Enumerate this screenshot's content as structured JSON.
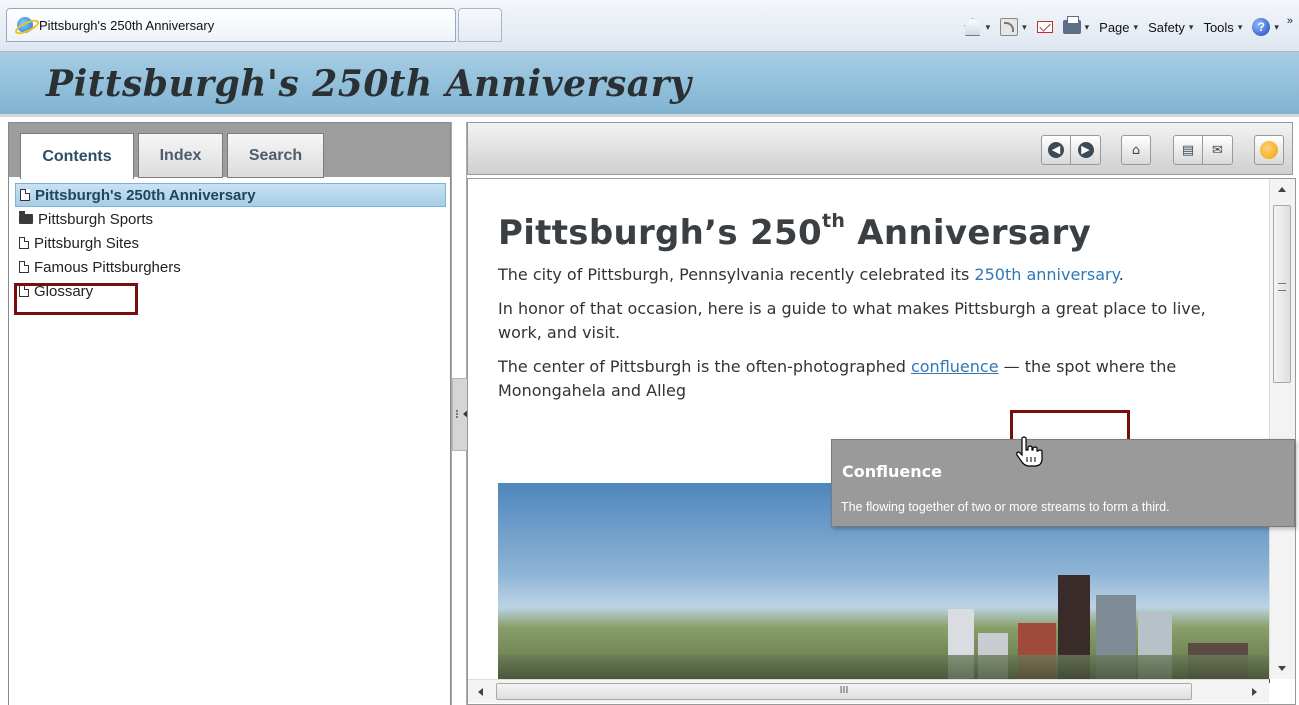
{
  "browser": {
    "tab_title": "Pittsburgh's 250th Anniversary",
    "commands": {
      "page": "Page",
      "safety": "Safety",
      "tools": "Tools",
      "help": "?"
    },
    "dropdown_arrow": "▾",
    "overflow": "»"
  },
  "header": {
    "title": "Pittsburgh's 250th Anniversary"
  },
  "nav": {
    "tabs": [
      "Contents",
      "Index",
      "Search"
    ],
    "active_tab": "Contents",
    "tree": [
      {
        "label": "Pittsburgh's 250th Anniversary",
        "icon": "page-icon",
        "selected": true
      },
      {
        "label": "Pittsburgh Sports",
        "icon": "folder-icon",
        "selected": false
      },
      {
        "label": "Pittsburgh Sites",
        "icon": "page-icon",
        "selected": false
      },
      {
        "label": "Famous Pittsburghers",
        "icon": "page-icon",
        "selected": false
      },
      {
        "label": "Glossary",
        "icon": "page-icon",
        "selected": false
      }
    ]
  },
  "toolbar": {
    "buttons": [
      "back-icon",
      "forward-icon",
      "home-icon",
      "print-icon",
      "email-icon",
      "options-icon"
    ]
  },
  "content": {
    "heading_main": "Pittsburgh’s 250",
    "heading_sup": "th",
    "heading_end": " Anniversary",
    "p1_before": "The city of Pittsburgh, Pennsylvania recently celebrated its ",
    "p1_link": "250th anniversary",
    "p1_after": ".",
    "p2": "In honor of that occasion, here is a guide to what makes Pittsburgh a great place to live, work, and visit.",
    "p3_before": "The center of Pittsburgh is the often-photographed ",
    "p3_link": "confluence",
    "p3_after": " — the spot where the Monongahela and Alleg"
  },
  "tooltip": {
    "title": "Confluence",
    "body": "The flowing together of two or more streams to form a third."
  },
  "scrollbar": {
    "h_grip": "III"
  },
  "colors": {
    "header_bg": "#8fbfd9",
    "link": "#2f78b5",
    "highlight_box": "#7a0d0d",
    "tooltip_bg": "#9a9a9a"
  }
}
